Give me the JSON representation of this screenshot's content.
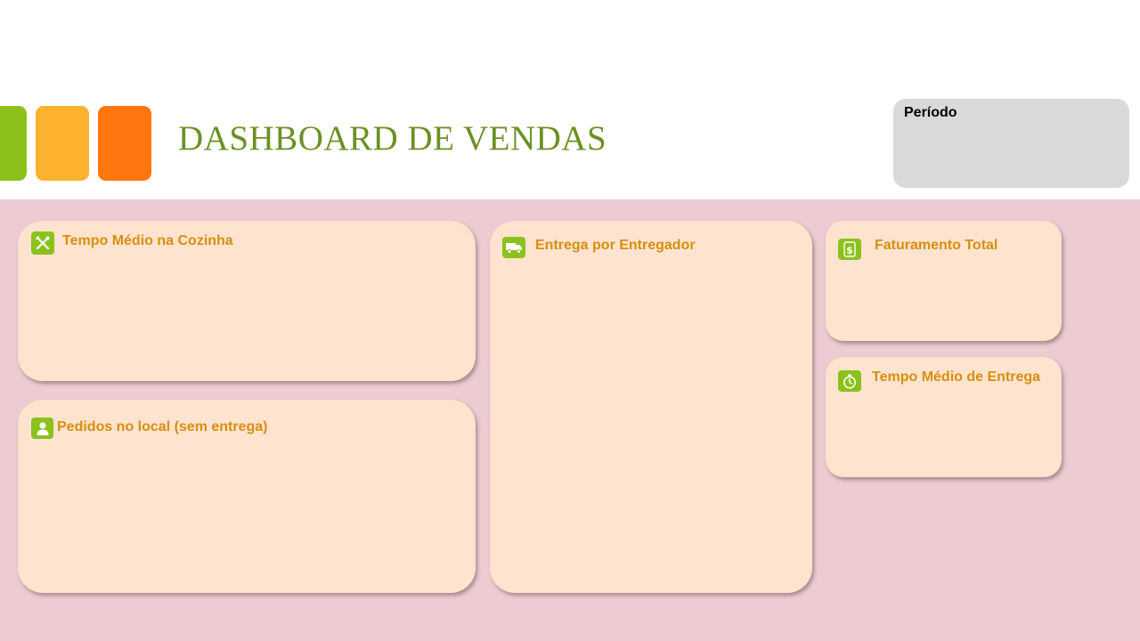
{
  "header": {
    "title": "DASHBOARD DE VENDAS",
    "period_label": "Período",
    "swatch_colors": [
      "#8CC11B",
      "#FDB22F",
      "#FF760F"
    ]
  },
  "cards": {
    "kitchen_time": {
      "title": "Tempo Médio na Cozinha",
      "icon": "utensils-icon"
    },
    "local_orders": {
      "title": "Pedidos no local (sem entrega)",
      "icon": "person-icon"
    },
    "delivery_by_courier": {
      "title": "Entrega por Entregador",
      "icon": "truck-icon"
    },
    "total_revenue": {
      "title": "Faturamento Total",
      "icon": "dollar-icon"
    },
    "delivery_time": {
      "title": "Tempo Médio de Entrega",
      "icon": "stopwatch-icon"
    }
  },
  "colors": {
    "background": "#EDCBD2",
    "card": "#FEE3CF",
    "card_title": "#D98E0C",
    "title": "#6B9122",
    "icon_bg": "#8CC11B",
    "period_bg": "#D9D9D9"
  }
}
